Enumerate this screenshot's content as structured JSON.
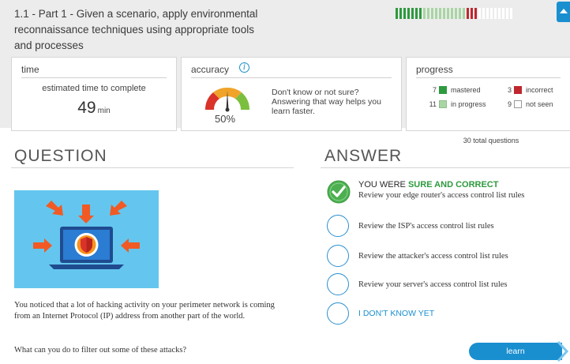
{
  "header": {
    "title": "1.1 - Part 1 - Given a scenario, apply environmental reconnaissance techniques using appropriate tools and processes",
    "progress_segments": [
      "mastered",
      "mastered",
      "mastered",
      "mastered",
      "mastered",
      "mastered",
      "mastered",
      "inprogress",
      "inprogress",
      "inprogress",
      "inprogress",
      "inprogress",
      "inprogress",
      "inprogress",
      "inprogress",
      "inprogress",
      "inprogress",
      "inprogress",
      "incorrect",
      "incorrect",
      "incorrect",
      "notseen",
      "notseen",
      "notseen",
      "notseen",
      "notseen",
      "notseen",
      "notseen",
      "notseen",
      "notseen"
    ],
    "collapse_icon": "chevron-up-icon"
  },
  "time": {
    "label": "time",
    "sub": "estimated time to complete",
    "value": "49",
    "unit": "min"
  },
  "accuracy": {
    "label": "accuracy",
    "info_icon": "info-icon",
    "percent": "50%",
    "percent_value": 50,
    "hint": "Don't know or not sure? Answering that way helps you learn faster."
  },
  "progress": {
    "label": "progress",
    "mastered_count": "7",
    "mastered_label": "mastered",
    "incorrect_count": "3",
    "incorrect_label": "incorrect",
    "inprogress_count": "11",
    "inprogress_label": "in progress",
    "notseen_count": "9",
    "notseen_label": "not seen",
    "total": "30 total questions"
  },
  "question": {
    "heading": "QUESTION",
    "illustration_icon": "laptop-shield-icon",
    "text": "You noticed that a lot of hacking activity on your perimeter network is coming from an Internet Protocol (IP) address from another part of the world.",
    "ask": "What can you do to filter out some of these attacks?"
  },
  "answer": {
    "heading": "ANSWER",
    "result_prefix": "YOU WERE",
    "result_status": "SURE AND CORRECT",
    "options": [
      "Review your edge router's access control list rules",
      "Review the ISP's access control list rules",
      "Review the attacker's access control list rules",
      "Review your server's access control list rules"
    ],
    "dont_know": "I DON'T KNOW YET"
  },
  "learn_button": "learn",
  "colors": {
    "accent": "#1a8fd0",
    "mastered": "#2d9a3e",
    "inprogress": "#a8d5a4",
    "incorrect": "#c0262d",
    "illustration_bg": "#64c6ee"
  }
}
